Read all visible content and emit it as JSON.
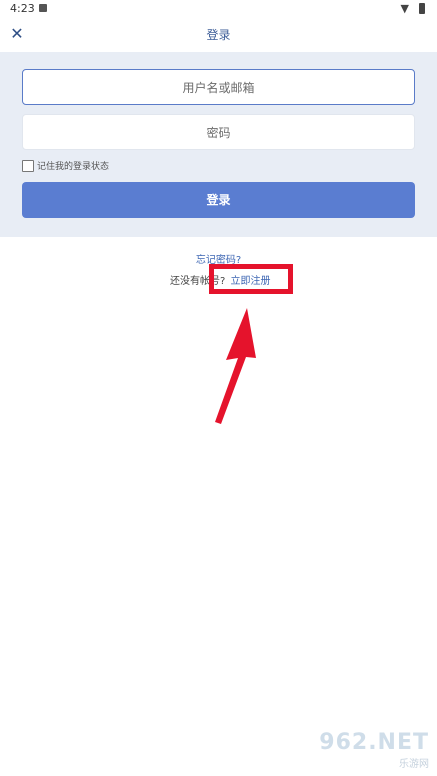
{
  "status_bar": {
    "time": "4:23"
  },
  "header": {
    "title": "登录",
    "close_icon": "close-icon"
  },
  "form": {
    "username_placeholder": "用户名或邮箱",
    "password_placeholder": "密码",
    "remember_label": "记住我的登录状态",
    "remember_checked": false,
    "login_button": "登录"
  },
  "links": {
    "forgot_password": "忘记密码?",
    "no_account_prompt": "还没有帐号?",
    "register_now": "立即注册"
  },
  "annotation": {
    "highlight_color": "#e5132c"
  },
  "watermark": {
    "brand": "962.NET",
    "sub": "乐游网"
  }
}
